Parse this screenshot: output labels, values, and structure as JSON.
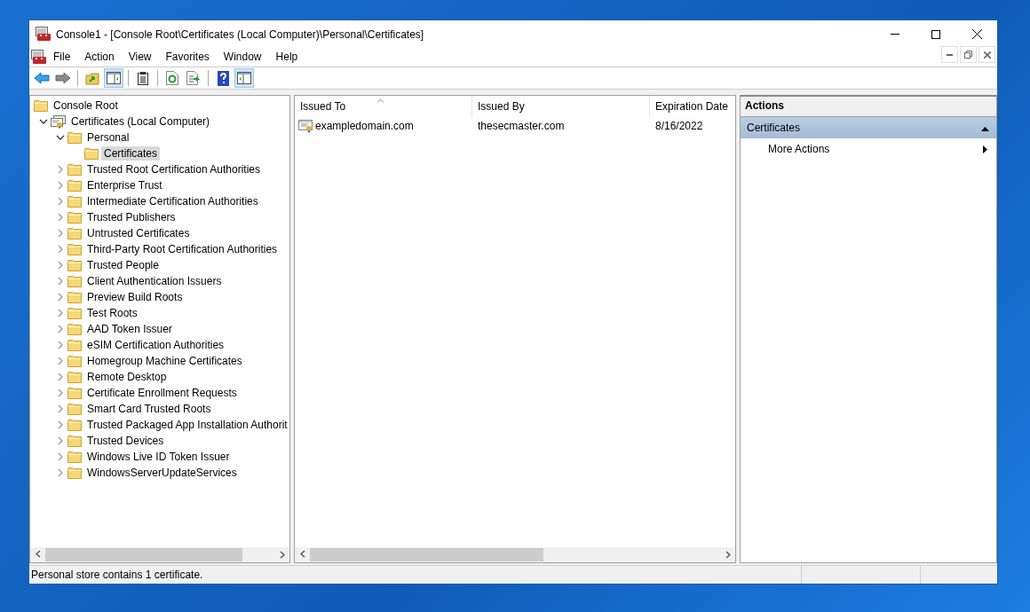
{
  "window": {
    "title": "Console1 - [Console Root\\Certificates (Local Computer)\\Personal\\Certificates]"
  },
  "menu": [
    "File",
    "Action",
    "View",
    "Favorites",
    "Window",
    "Help"
  ],
  "toolbar": [
    {
      "kind": "back",
      "pressed": false
    },
    {
      "kind": "forward",
      "pressed": false
    },
    {
      "kind": "sep"
    },
    {
      "kind": "up",
      "pressed": false
    },
    {
      "kind": "tree",
      "pressed": true
    },
    {
      "kind": "sep"
    },
    {
      "kind": "clipboard",
      "pressed": false
    },
    {
      "kind": "sep"
    },
    {
      "kind": "refresh",
      "pressed": false
    },
    {
      "kind": "export",
      "pressed": false
    },
    {
      "kind": "sep"
    },
    {
      "kind": "help",
      "pressed": false
    },
    {
      "kind": "actionpane",
      "pressed": true
    }
  ],
  "tree": [
    {
      "label": "Console Root",
      "kind": "folder",
      "selected": false,
      "children": [
        {
          "label": "Certificates (Local Computer)",
          "kind": "store",
          "expanded": true,
          "selected": false,
          "children": [
            {
              "label": "Personal",
              "kind": "folder",
              "expanded": true,
              "selected": false,
              "children": [
                {
                  "label": "Certificates",
                  "kind": "folder",
                  "selected": true
                }
              ]
            },
            {
              "label": "Trusted Root Certification Authorities",
              "kind": "folder",
              "expanded": false,
              "selected": false
            },
            {
              "label": "Enterprise Trust",
              "kind": "folder",
              "expanded": false,
              "selected": false
            },
            {
              "label": "Intermediate Certification Authorities",
              "kind": "folder",
              "expanded": false,
              "selected": false
            },
            {
              "label": "Trusted Publishers",
              "kind": "folder",
              "expanded": false,
              "selected": false
            },
            {
              "label": "Untrusted Certificates",
              "kind": "folder",
              "expanded": false,
              "selected": false
            },
            {
              "label": "Third-Party Root Certification Authorities",
              "kind": "folder",
              "expanded": false,
              "selected": false
            },
            {
              "label": "Trusted People",
              "kind": "folder",
              "expanded": false,
              "selected": false
            },
            {
              "label": "Client Authentication Issuers",
              "kind": "folder",
              "expanded": false,
              "selected": false
            },
            {
              "label": "Preview Build Roots",
              "kind": "folder",
              "expanded": false,
              "selected": false
            },
            {
              "label": "Test Roots",
              "kind": "folder",
              "expanded": false,
              "selected": false
            },
            {
              "label": "AAD Token Issuer",
              "kind": "folder",
              "expanded": false,
              "selected": false
            },
            {
              "label": "eSIM Certification Authorities",
              "kind": "folder",
              "expanded": false,
              "selected": false
            },
            {
              "label": "Homegroup Machine Certificates",
              "kind": "folder",
              "expanded": false,
              "selected": false
            },
            {
              "label": "Remote Desktop",
              "kind": "folder",
              "expanded": false,
              "selected": false
            },
            {
              "label": "Certificate Enrollment Requests",
              "kind": "folder",
              "expanded": false,
              "selected": false
            },
            {
              "label": "Smart Card Trusted Roots",
              "kind": "folder",
              "expanded": false,
              "selected": false
            },
            {
              "label": "Trusted Packaged App Installation Authorit",
              "kind": "folder",
              "expanded": false,
              "selected": false
            },
            {
              "label": "Trusted Devices",
              "kind": "folder",
              "expanded": false,
              "selected": false
            },
            {
              "label": "Windows Live ID Token Issuer",
              "kind": "folder",
              "expanded": false,
              "selected": false
            },
            {
              "label": "WindowsServerUpdateServices",
              "kind": "folder",
              "expanded": false,
              "selected": false
            }
          ]
        }
      ]
    }
  ],
  "table": {
    "columns": [
      {
        "label": "Issued To",
        "sorted": true
      },
      {
        "label": "Issued By",
        "sorted": false
      },
      {
        "label": "Expiration Date",
        "sorted": false
      }
    ],
    "rows": [
      [
        "exampledomain.com",
        "thesecmaster.com",
        "8/16/2022"
      ]
    ]
  },
  "actions": {
    "title": "Actions",
    "section": {
      "label": "Certificates",
      "expanded": true
    },
    "items": [
      "More Actions"
    ]
  },
  "status_bar": {
    "text": "Personal store contains 1 certificate."
  }
}
